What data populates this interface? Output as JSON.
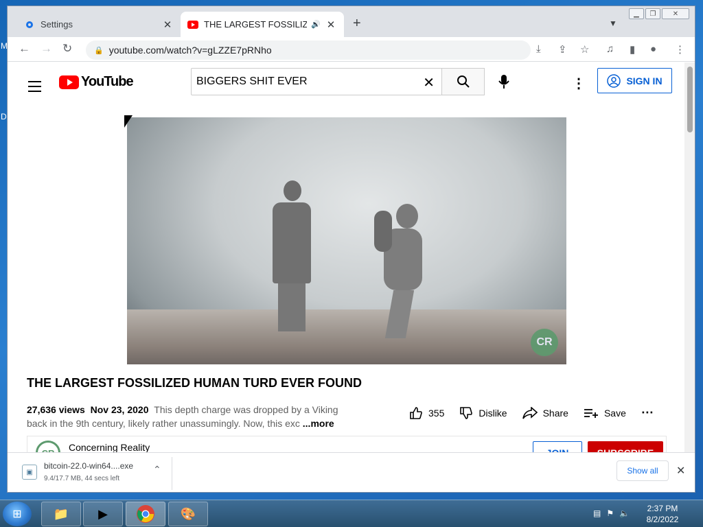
{
  "desktop": {
    "letter_m": "M",
    "letter_d": "D"
  },
  "browser": {
    "tabs": [
      {
        "title": "Settings",
        "active": false,
        "close": "✕"
      },
      {
        "title": "THE LARGEST FOSSILIZED HU",
        "active": true,
        "close": "✕"
      }
    ],
    "new_tab": "+",
    "url": "youtube.com/watch?v=gLZZE7pRNho"
  },
  "youtube": {
    "logo_text": "YouTube",
    "search_value": "BIGGERS SHIT EVER",
    "sign_in_label": "SIGN IN",
    "video_title": "THE LARGEST FOSSILIZED HUMAN TURD EVER FOUND",
    "views": "27,636 views",
    "date": "Nov 23, 2020",
    "description": "This depth charge was dropped by a Viking back in the 9th century, likely rather unassumingly. Now, this exc",
    "more_label": "...more",
    "likes": "355",
    "dislike_label": "Dislike",
    "share_label": "Share",
    "save_label": "Save",
    "channel_name": "Concerning Reality",
    "channel_avatar": "CR",
    "watermark": "CR",
    "join_label": "JOIN",
    "subscribe_label": "SUBSCRIBE",
    "colors": {
      "brand_red": "#ff0000",
      "subscribe_red": "#cc0000",
      "link_blue": "#065fd4"
    }
  },
  "download": {
    "filename": "bitcoin-22.0-win64....exe",
    "status": "9.4/17.7 MB, 44 secs left",
    "show_all_label": "Show all"
  },
  "taskbar": {
    "time": "2:37 PM",
    "date": "8/2/2022"
  }
}
